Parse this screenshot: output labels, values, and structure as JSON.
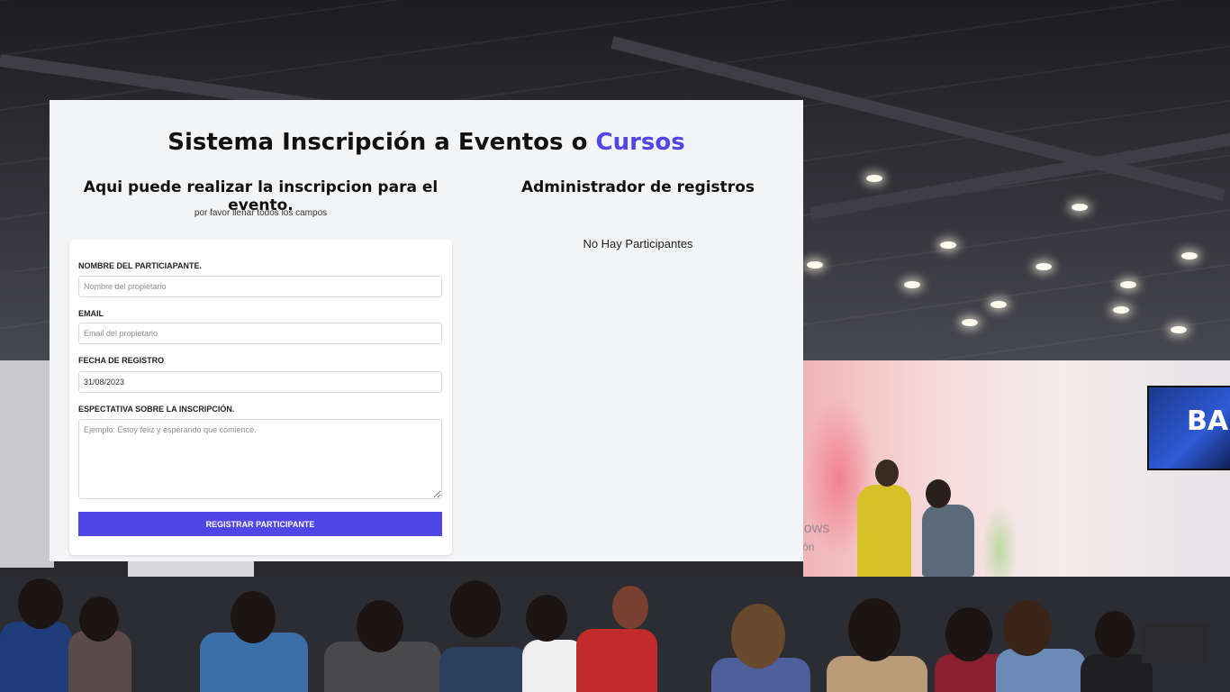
{
  "app": {
    "title_main": "Sistema Inscripción a Eventos o",
    "title_accent": "Cursos",
    "accent_color": "#4f46e5"
  },
  "form": {
    "heading": "Aqui puede realizar la inscripcion para el evento.",
    "subheading": "por favor llenar todos los campos",
    "name_label": "NOMBRE DEL PARTICIAPANTE.",
    "name_placeholder": "Nombre del propietario",
    "email_label": "EMAIL",
    "email_placeholder": "Email del propietario",
    "date_label": "FECHA DE REGISTRO",
    "date_value": "31/08/2023",
    "expectation_label": "ESPECTATIVA SOBRE LA INSCRIPCIÓN.",
    "expectation_placeholder": "Ejemplo: Estoy feliz y esperando que comience.",
    "submit_label": "REGISTRAR PARTICIPANTE"
  },
  "admin": {
    "heading": "Administrador de registros",
    "empty_message": "No Hay Participantes"
  },
  "background": {
    "screen_text": "BA",
    "watermark_line1": "Activar Windows",
    "watermark_line2": "Ve a Configuración"
  }
}
